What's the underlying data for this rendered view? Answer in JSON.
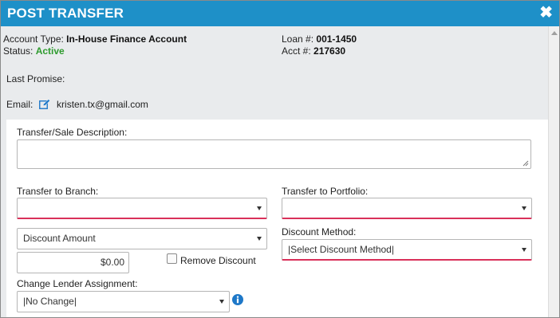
{
  "dialog": {
    "title": "POST TRANSFER",
    "close_glyph": "✖",
    "close_icon": "close-icon"
  },
  "account": {
    "account_type_label": "Account Type:",
    "account_type_value": "In-House Finance Account",
    "status_label": "Status:",
    "status_value": "Active",
    "status_color": "#2e9b2e",
    "loan_label": "Loan #:",
    "loan_value": "001-1450",
    "acct_label": "Acct #:",
    "acct_value": "217630",
    "last_promise_label": "Last Promise:",
    "email_label": "Email:",
    "email_icon": "edit-icon",
    "email_value": "kristen.tx@gmail.com"
  },
  "form": {
    "description_label": "Transfer/Sale Description:",
    "description_value": "",
    "branch_label": "Transfer to Branch:",
    "branch_value": "",
    "portfolio_label": "Transfer to Portfolio:",
    "portfolio_value": "",
    "discount_type_value": "Discount Amount",
    "discount_amount_value": "$0.00",
    "remove_discount_label": "Remove Discount",
    "remove_discount_checked": false,
    "discount_method_label": "Discount Method:",
    "discount_method_value": "|Select Discount Method|",
    "lender_label": "Change Lender Assignment:",
    "lender_value": "|No Change|",
    "lender_info_icon": "info-icon"
  },
  "colors": {
    "titlebar": "#1e90c8",
    "required_underline": "#d9305a",
    "info_icon": "#1e78c8"
  }
}
